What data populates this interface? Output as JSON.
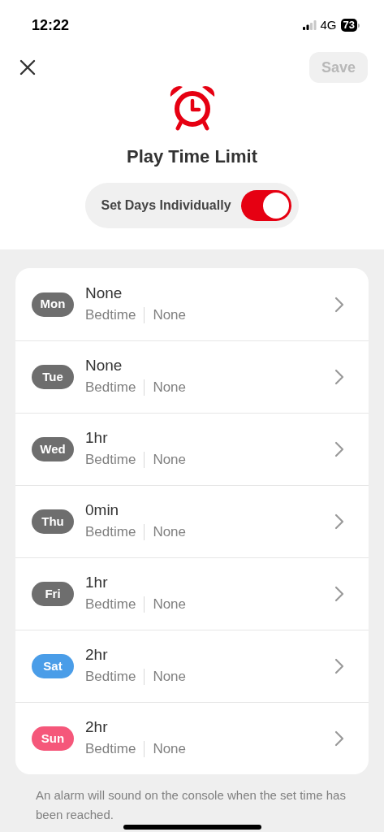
{
  "status_bar": {
    "time": "12:22",
    "network": "4G",
    "battery": "73"
  },
  "header": {
    "save": {
      "label": "Save",
      "disabled": true
    },
    "title": "Play Time Limit"
  },
  "toggle": {
    "label": "Set Days Individually",
    "on": true
  },
  "days": [
    {
      "day": "Mon",
      "color": "#6e6e6e",
      "limit": "None",
      "bedtime_label": "Bedtime",
      "bedtime": "None"
    },
    {
      "day": "Tue",
      "color": "#6e6e6e",
      "limit": "None",
      "bedtime_label": "Bedtime",
      "bedtime": "None"
    },
    {
      "day": "Wed",
      "color": "#6e6e6e",
      "limit": "1hr",
      "bedtime_label": "Bedtime",
      "bedtime": "None"
    },
    {
      "day": "Thu",
      "color": "#6e6e6e",
      "limit": "0min",
      "bedtime_label": "Bedtime",
      "bedtime": "None"
    },
    {
      "day": "Fri",
      "color": "#6e6e6e",
      "limit": "1hr",
      "bedtime_label": "Bedtime",
      "bedtime": "None"
    },
    {
      "day": "Sat",
      "color": "#4a9de8",
      "limit": "2hr",
      "bedtime_label": "Bedtime",
      "bedtime": "None"
    },
    {
      "day": "Sun",
      "color": "#f5577a",
      "limit": "2hr",
      "bedtime_label": "Bedtime",
      "bedtime": "None"
    }
  ],
  "footnote": "An alarm will sound on the console when the set time has been reached."
}
